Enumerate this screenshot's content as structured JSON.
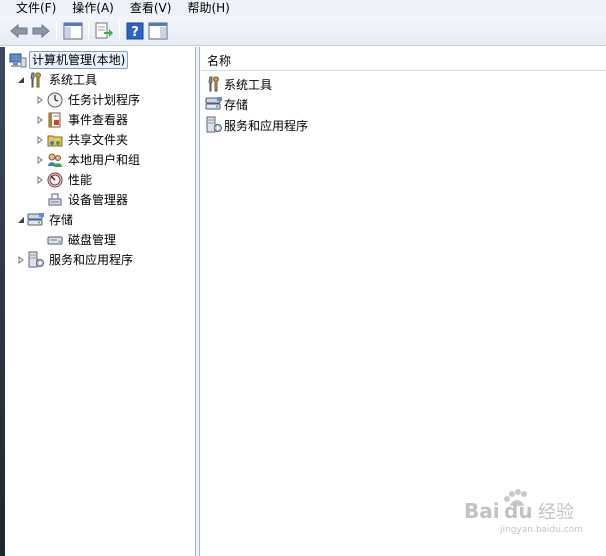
{
  "menu": {
    "items": [
      "文件(F)",
      "操作(A)",
      "查看(V)",
      "帮助(H)"
    ]
  },
  "toolbar": {
    "buttons": [
      "back-icon",
      "forward-icon",
      "show-hide-tree-icon",
      "export-list-icon",
      "help-icon",
      "show-hide-action-pane-icon"
    ]
  },
  "tree": {
    "root": "计算机管理(本地)",
    "system_tools": "系统工具",
    "task_scheduler": "任务计划程序",
    "event_viewer": "事件查看器",
    "shared_folders": "共享文件夹",
    "local_users": "本地用户和组",
    "performance": "性能",
    "device_manager": "设备管理器",
    "storage": "存储",
    "disk_management": "磁盘管理",
    "services_apps": "服务和应用程序"
  },
  "list": {
    "column_name": "名称",
    "items": [
      "系统工具",
      "存储",
      "服务和应用程序"
    ]
  },
  "watermark": {
    "brand": "Bai",
    "brand_tail": "du",
    "suffix": "经验",
    "url": "jingyan.baidu.com"
  },
  "colors": {
    "selection_border": "#7da2ce",
    "selection_bg": "#e8f1fc",
    "toolbar_bg": "#e6ecf5"
  }
}
